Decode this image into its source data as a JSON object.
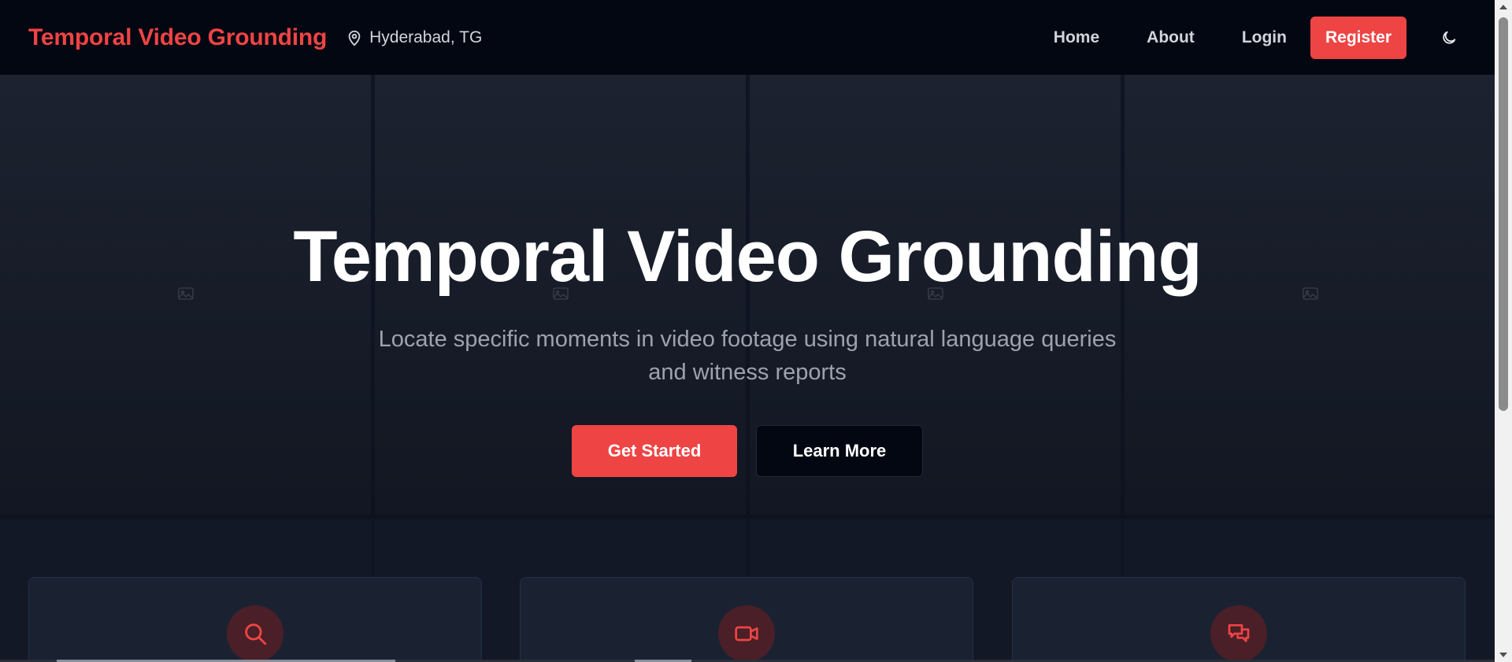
{
  "header": {
    "brand": "Temporal Video Grounding",
    "location": "Hyderabad, TG",
    "nav_links": [
      "Home",
      "About",
      "Login"
    ],
    "register_label": "Register",
    "theme_icon": "moon-icon"
  },
  "hero": {
    "title": "Temporal Video Grounding",
    "subtitle": "Locate specific moments in video footage using natural language queries and witness reports",
    "primary_button": "Get Started",
    "secondary_button": "Learn More",
    "tile_icon": "image-placeholder-icon"
  },
  "features": {
    "cards": [
      {
        "icon": "search-icon"
      },
      {
        "icon": "video-camera-icon"
      },
      {
        "icon": "chat-bubbles-icon"
      }
    ]
  },
  "colors": {
    "accent": "#ef4444",
    "nav_bg": "#030712",
    "card_bg": "#1a2232",
    "icon_circle": "#4a1f27"
  }
}
